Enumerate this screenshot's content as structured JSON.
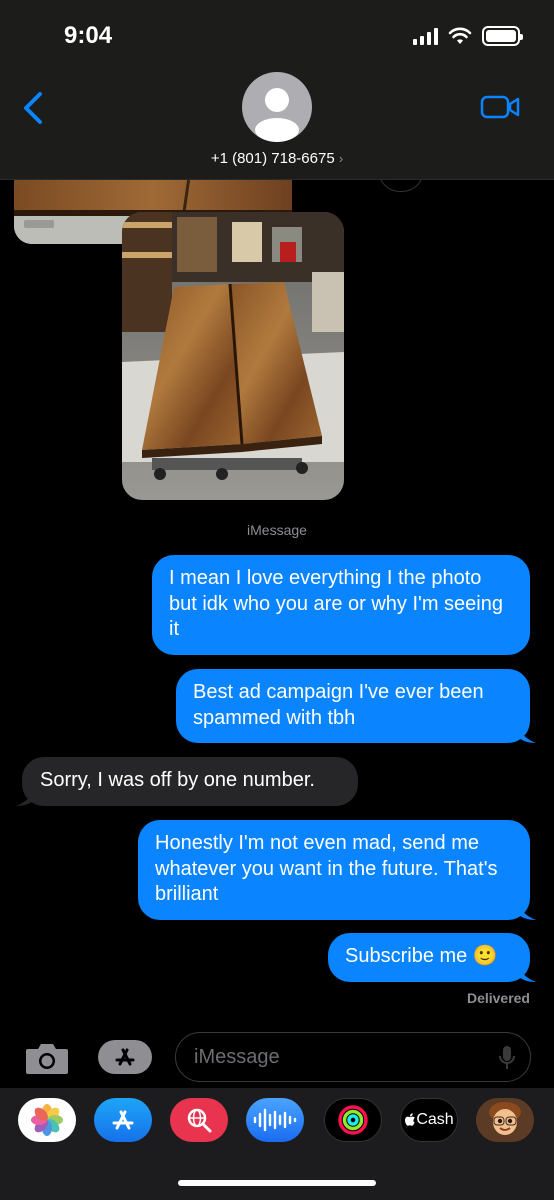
{
  "status_bar": {
    "time": "9:04"
  },
  "header": {
    "contact": "+1 (801) 718-6675",
    "chevron": "›"
  },
  "thread": {
    "service_label": "iMessage",
    "messages": [
      {
        "from": "me",
        "text": "I mean I love everything I the photo but idk who you are or why I'm seeing it"
      },
      {
        "from": "me",
        "text": "Best ad campaign I've ever been spammed with tbh"
      },
      {
        "from": "them",
        "text": "Sorry, I was off by one number."
      },
      {
        "from": "me",
        "text": "Honestly I'm not even mad, send me whatever you want in the future. That's brilliant"
      },
      {
        "from": "me",
        "text": "Subscribe me 🙂"
      }
    ],
    "delivery_status": "Delivered"
  },
  "composer": {
    "placeholder": "iMessage"
  },
  "app_drawer": [
    {
      "name": "photos-app-icon"
    },
    {
      "name": "app-store-icon"
    },
    {
      "name": "search-images-icon"
    },
    {
      "name": "audio-message-icon"
    },
    {
      "name": "activity-rings-icon"
    },
    {
      "name": "apple-cash-icon",
      "label": "Cash"
    },
    {
      "name": "memoji-icon"
    }
  ],
  "colors": {
    "sent_bubble": "#0a84ff",
    "received_bubble": "#262628",
    "accent": "#0a84ff"
  }
}
